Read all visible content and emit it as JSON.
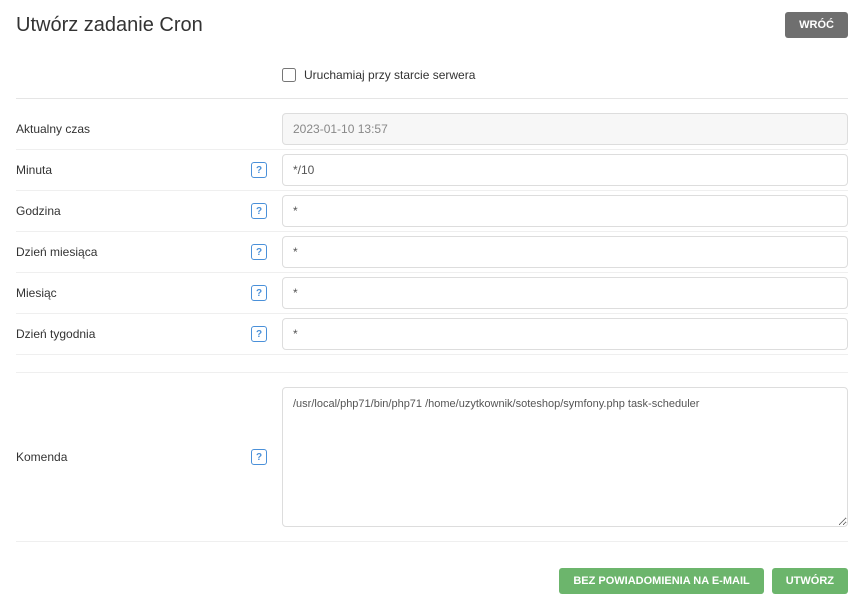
{
  "header": {
    "title": "Utwórz zadanie Cron",
    "back_label": "WRÓĆ"
  },
  "checkbox": {
    "label": "Uruchamiaj przy starcie serwera"
  },
  "rows": {
    "current_time": {
      "label": "Aktualny czas",
      "value": "2023-01-10 13:57"
    },
    "minute": {
      "label": "Minuta",
      "value": "*/10"
    },
    "hour": {
      "label": "Godzina",
      "value": "*"
    },
    "day_month": {
      "label": "Dzień miesiąca",
      "value": "*"
    },
    "month": {
      "label": "Miesiąc",
      "value": "*"
    },
    "day_week": {
      "label": "Dzień tygodnia",
      "value": "*"
    },
    "command": {
      "label": "Komenda",
      "value": "/usr/local/php71/bin/php71 /home/uzytkownik/soteshop/symfony.php task-scheduler"
    }
  },
  "help_glyph": "?",
  "footer": {
    "no_email_label": "BEZ POWIADOMIENIA NA E-MAIL",
    "create_label": "UTWÓRZ"
  }
}
